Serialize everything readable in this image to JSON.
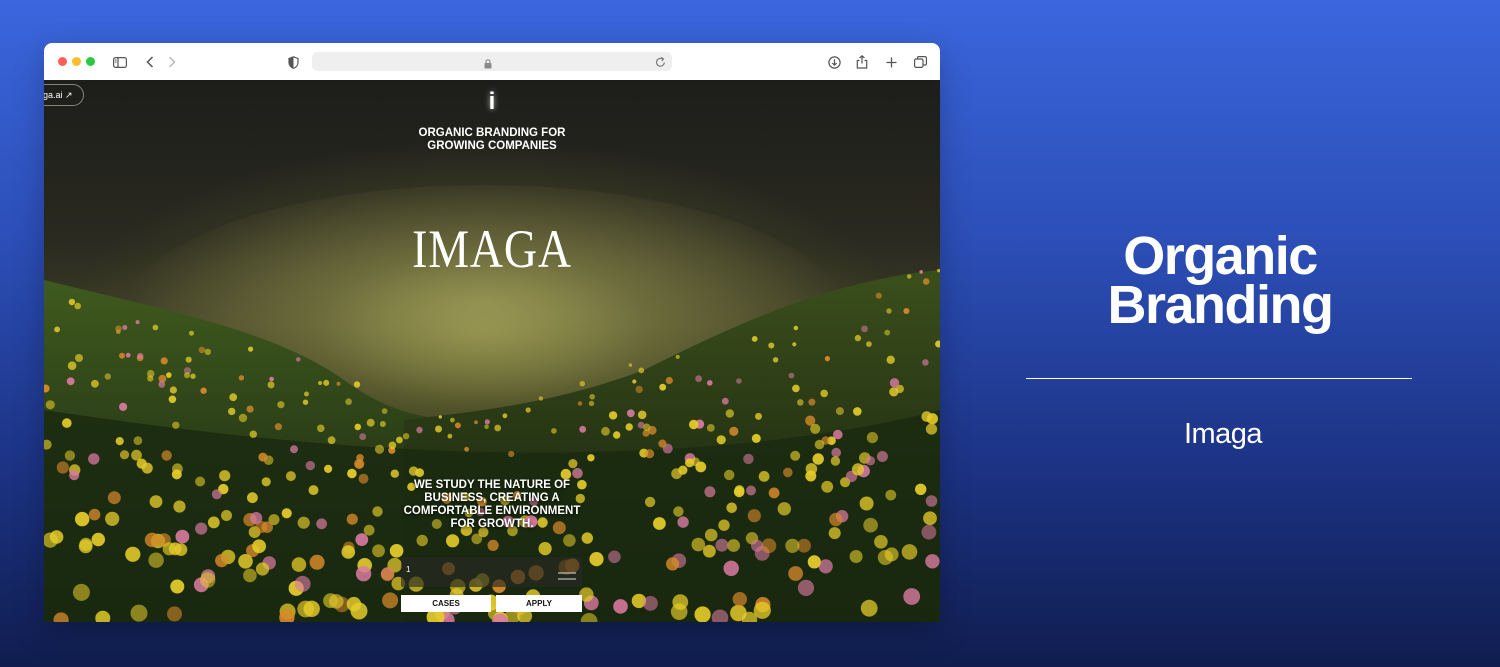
{
  "browser": {
    "address_bar": ""
  },
  "site": {
    "domain_pill": "ga.ai ↗",
    "logo_mark": "i",
    "tagline_line1": "ORGANIC BRANDING FOR",
    "tagline_line2": "GROWING COMPANIES",
    "wordmark": "IMAGA",
    "mission_lines": [
      "WE STUDY THE NATURE OF",
      "BUSINESS, CREATING A",
      "COMFORTABLE ENVIRONMENT",
      "FOR GROWTH."
    ],
    "nav_number": "1",
    "cases_label": "CASES",
    "apply_label": "APPLY"
  },
  "panel": {
    "headline_line1": "Organic",
    "headline_line2": "Branding",
    "brand": "Imaga"
  },
  "icons": {
    "sidebar": "sidebar-icon",
    "back": "chevron-left-icon",
    "forward": "chevron-right-icon",
    "privacy": "shield-icon",
    "lock": "lock-icon",
    "reload": "reload-icon",
    "download": "download-icon",
    "share": "share-icon",
    "new_tab": "plus-icon",
    "tabs": "tabs-overview-icon",
    "menu": "hamburger-menu-icon"
  },
  "colors": {
    "background_top": "#3b66dd",
    "background_bottom": "#101d4e",
    "flower_yellow": "#e6cc2a",
    "flower_pink": "#d97aa0",
    "flower_orange": "#d88a2a"
  }
}
